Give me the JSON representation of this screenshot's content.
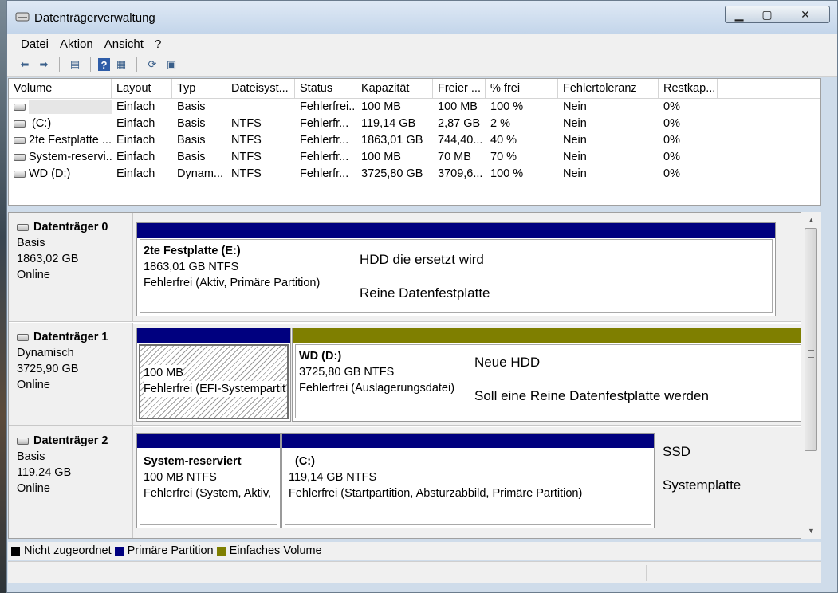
{
  "window": {
    "title": "Datenträgerverwaltung"
  },
  "menu": [
    "Datei",
    "Aktion",
    "Ansicht",
    "?"
  ],
  "toolbar_icons": [
    "back-arrow-icon",
    "forward-arrow-icon",
    "properties-icon",
    "help-icon",
    "list-view-icon",
    "refresh-icon",
    "rescan-icon"
  ],
  "volume_table": {
    "columns": [
      "Volume",
      "Layout",
      "Typ",
      "Dateisyst...",
      "Status",
      "Kapazität",
      "Freier ...",
      "% frei",
      "Fehlertoleranz",
      "Restkap..."
    ],
    "rows": [
      [
        "",
        "Einfach",
        "Basis",
        "",
        "Fehlerfrei...",
        "100 MB",
        "100 MB",
        "100 %",
        "Nein",
        "0%"
      ],
      [
        "(C:)",
        "Einfach",
        "Basis",
        "NTFS",
        "Fehlerfr...",
        "119,14 GB",
        "2,87 GB",
        "2 %",
        "Nein",
        "0%"
      ],
      [
        "2te Festplatte ...",
        "Einfach",
        "Basis",
        "NTFS",
        "Fehlerfr...",
        "1863,01 GB",
        "744,40...",
        "40 %",
        "Nein",
        "0%"
      ],
      [
        "System-reservi...",
        "Einfach",
        "Basis",
        "NTFS",
        "Fehlerfr...",
        "100 MB",
        "70 MB",
        "70 %",
        "Nein",
        "0%"
      ],
      [
        "WD (D:)",
        "Einfach",
        "Dynam...",
        "NTFS",
        "Fehlerfr...",
        "3725,80 GB",
        "3709,6...",
        "100 %",
        "Nein",
        "0%"
      ]
    ]
  },
  "disks": [
    {
      "name": "Datenträger 0",
      "type": "Basis",
      "size": "1863,02 GB",
      "state": "Online",
      "partitions": [
        {
          "title": "2te Festplatte  (E:)",
          "size": "1863,01 GB NTFS",
          "status": "Fehlerfrei (Aktiv, Primäre Partition)",
          "kind": "primary"
        }
      ],
      "notes": [
        "HDD die ersetzt wird",
        "Reine Datenfestplatte"
      ]
    },
    {
      "name": "Datenträger 1",
      "type": "Dynamisch",
      "size": "3725,90 GB",
      "state": "Online",
      "partitions": [
        {
          "title": "",
          "size": "100 MB",
          "status": "Fehlerfrei (EFI-Systempartit",
          "kind": "primary"
        },
        {
          "title": "WD  (D:)",
          "size": "3725,80 GB NTFS",
          "status": "Fehlerfrei (Auslagerungsdatei)",
          "kind": "simple"
        }
      ],
      "notes": [
        "Neue HDD",
        "Soll eine Reine Datenfestplatte werden"
      ]
    },
    {
      "name": "Datenträger 2",
      "type": "Basis",
      "size": "119,24 GB",
      "state": "Online",
      "partitions": [
        {
          "title": "System-reserviert",
          "size": "100 MB NTFS",
          "status": "Fehlerfrei (System, Aktiv,",
          "kind": "primary"
        },
        {
          "title": "(C:)",
          "size": "119,14 GB NTFS",
          "status": "Fehlerfrei (Startpartition, Absturzabbild, Primäre Partition)",
          "kind": "primary"
        }
      ],
      "notes": [
        "SSD",
        "Systemplatte"
      ]
    }
  ],
  "legend": [
    {
      "label": "Nicht zugeordnet",
      "color": "#000000"
    },
    {
      "label": "Primäre Partition",
      "color": "#00007f"
    },
    {
      "label": "Einfaches Volume",
      "color": "#7f7f00"
    }
  ],
  "colors": {
    "primary": "#00007f",
    "simple": "#7f7f00"
  }
}
